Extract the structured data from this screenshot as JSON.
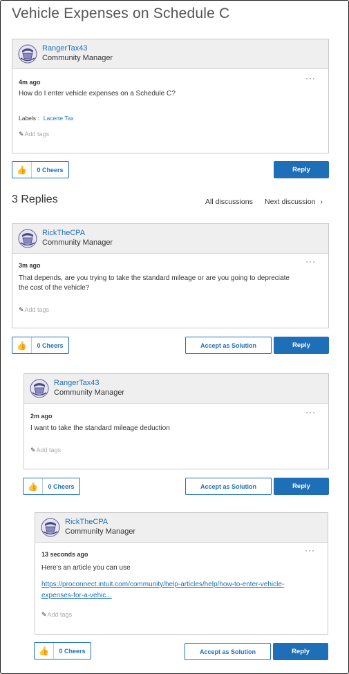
{
  "page": {
    "title": "Vehicle Expenses on Schedule C"
  },
  "colors": {
    "accent": "#1f6fb8",
    "header_bg": "#efefef"
  },
  "original_post": {
    "author": "RangerTax43",
    "role": "Community Manager",
    "time": "4m ago",
    "text": "How do I enter vehicle expenses on a Schedule C?",
    "labels_prefix": "Labels :",
    "label": "Lacerte Tax",
    "add_tags": "Add tags",
    "menu": "···",
    "cheers": "0 Cheers",
    "reply": "Reply"
  },
  "replies_header": {
    "title": "3 Replies",
    "all_discussions": "All discussions",
    "next_discussion": "Next discussion",
    "next_icon": "›"
  },
  "replies": [
    {
      "author": "RickTheCPA",
      "role": "Community Manager",
      "time": "3m ago",
      "text_line1": "That depends, are you trying to take the standard mileage or are you going to depreciate",
      "text_line2": "the cost of the vehicle?",
      "add_tags": "Add tags",
      "menu": "···",
      "cheers": "0 Cheers",
      "accept": "Accept as Solution",
      "reply": "Reply"
    },
    {
      "author": "RangerTax43",
      "role": "Community Manager",
      "time": "2m ago",
      "text_line1": "I want to take the standard mileage deduction",
      "add_tags": "Add tags",
      "menu": "···",
      "cheers": "0 Cheers",
      "accept": "Accept as Solution",
      "reply": "Reply"
    },
    {
      "author": "RickTheCPA",
      "role": "Community Manager",
      "time": "13 seconds ago",
      "text_line1": "Here's an article you can use",
      "link_line1": "https://proconnect.intuit.com/community/help-articles/help/how-to-enter-vehicle-",
      "link_line2": "expenses-for-a-vehic...",
      "add_tags": "Add tags",
      "menu": "···",
      "cheers": "0 Cheers",
      "accept": "Accept as Solution",
      "reply": "Reply"
    }
  ]
}
